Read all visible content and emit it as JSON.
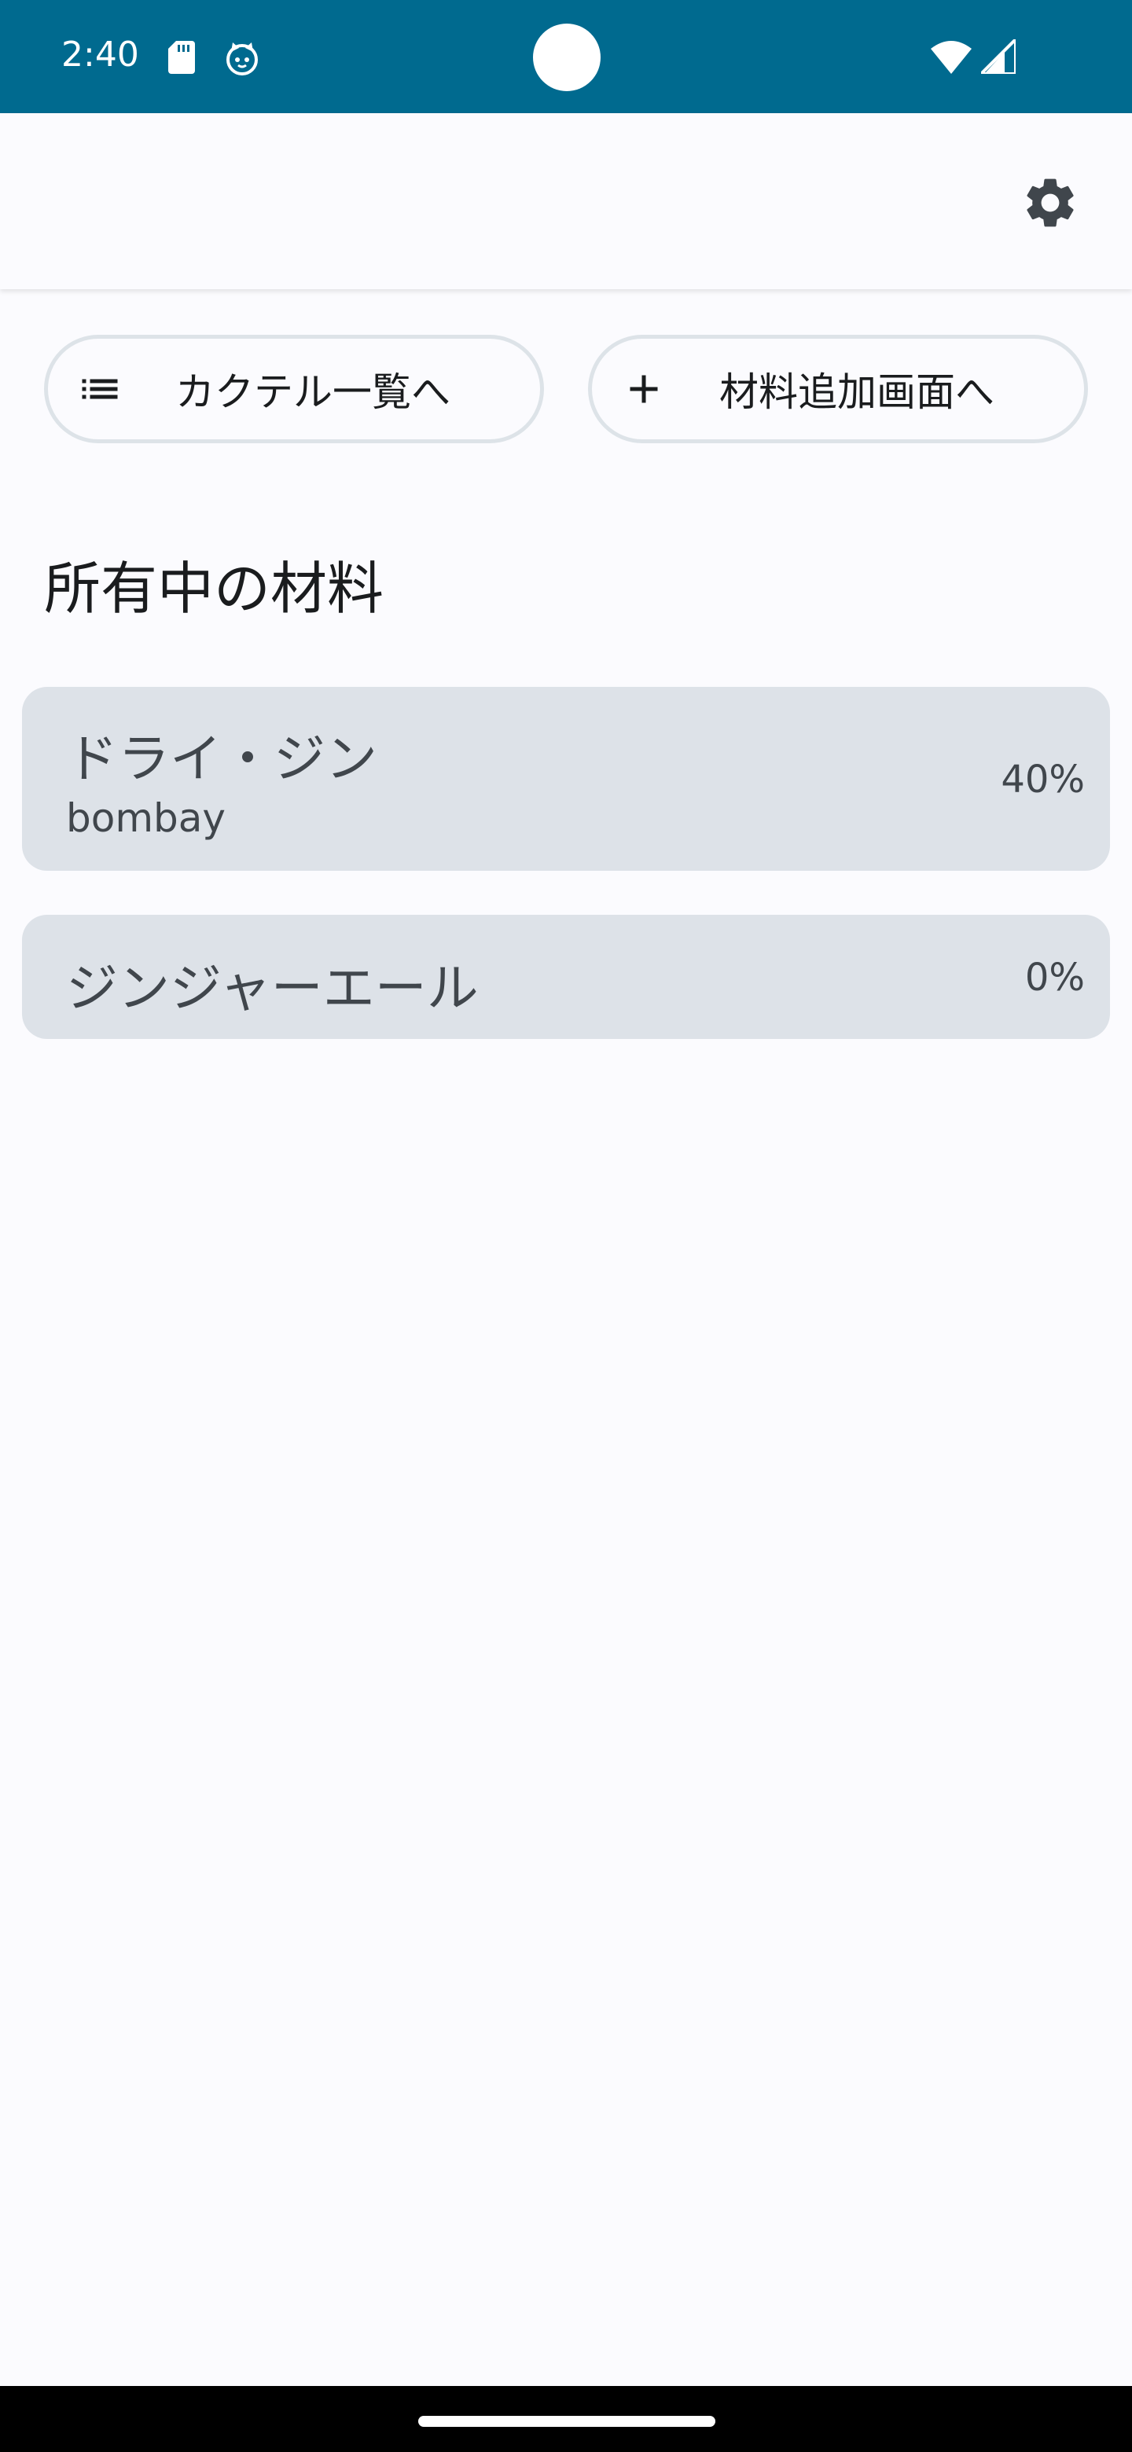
{
  "status_bar": {
    "time": "2:40",
    "background_color": "#006a8f",
    "icons": [
      "sd-card-icon",
      "cat-face-icon",
      "wifi-icon",
      "signal-icon"
    ]
  },
  "app_bar": {
    "settings_icon": "gear-icon"
  },
  "actions": {
    "cocktail_list": {
      "label": "カクテル一覧へ",
      "icon": "list-icon"
    },
    "add_ingredient": {
      "label": "材料追加画面へ",
      "icon": "plus-icon"
    }
  },
  "section_title": "所有中の材料",
  "ingredients": [
    {
      "name": "ドライ・ジン",
      "brand": "bombay",
      "abv": "40%"
    },
    {
      "name": "ジンジャーエール",
      "abv": "0%"
    }
  ],
  "colors": {
    "accent": "#006a8f",
    "card_background": "#dde2e8",
    "page_background": "#fbfbfe"
  }
}
